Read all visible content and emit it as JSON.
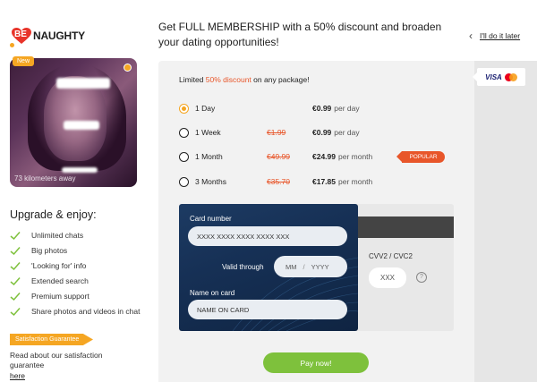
{
  "brand": {
    "logo_badge": "BE",
    "logo_word": "NAUGHTY"
  },
  "profile": {
    "new_badge": "New",
    "distance": "73 kilometers away"
  },
  "upgrade": {
    "title": "Upgrade & enjoy:",
    "features": [
      "Unlimited chats",
      "Big photos",
      "'Looking for' info",
      "Extended search",
      "Premium support",
      "Share photos and videos in chat"
    ]
  },
  "guarantee": {
    "tag": "Satisfaction Guarantee",
    "text": "Read about our satisfaction guarantee",
    "link": "here"
  },
  "header": {
    "headline": "Get FULL MEMBERSHIP with a 50% discount and broaden your dating opportunities!",
    "do_later": "I'll do it later"
  },
  "payment_methods": {
    "visa": "VISA"
  },
  "promo": {
    "prefix": "Limited ",
    "accent": "50% discount",
    "suffix": " on any package!"
  },
  "plans": [
    {
      "name": "1 Day",
      "old_price": "",
      "price": "€0.99",
      "period": "per day",
      "selected": true
    },
    {
      "name": "1 Week",
      "old_price": "€1.99",
      "price": "€0.99",
      "period": "per day",
      "selected": false
    },
    {
      "name": "1 Month",
      "old_price": "€49.99",
      "price": "€24.99",
      "period": "per month",
      "selected": false
    },
    {
      "name": "3 Months",
      "old_price": "€35.70",
      "price": "€17.85",
      "period": "per month",
      "selected": false
    }
  ],
  "popular_badge": "POPULAR",
  "card_form": {
    "card_number_label": "Card number",
    "card_number_placeholder": "XXXX XXXX XXXX XXXX XXX",
    "valid_through_label": "Valid through",
    "month_placeholder": "MM",
    "date_separator": "/",
    "year_placeholder": "YYYY",
    "name_label": "Name on card",
    "name_placeholder": "NAME ON CARD",
    "cvv_label": "CVV2 / CVC2",
    "cvv_placeholder": "XXX",
    "help_glyph": "?"
  },
  "pay_button": "Pay now!",
  "colors": {
    "accent_orange": "#f5a623",
    "discount_red": "#e8562a",
    "pay_green": "#7ec13c",
    "card_navy": "#163055"
  }
}
